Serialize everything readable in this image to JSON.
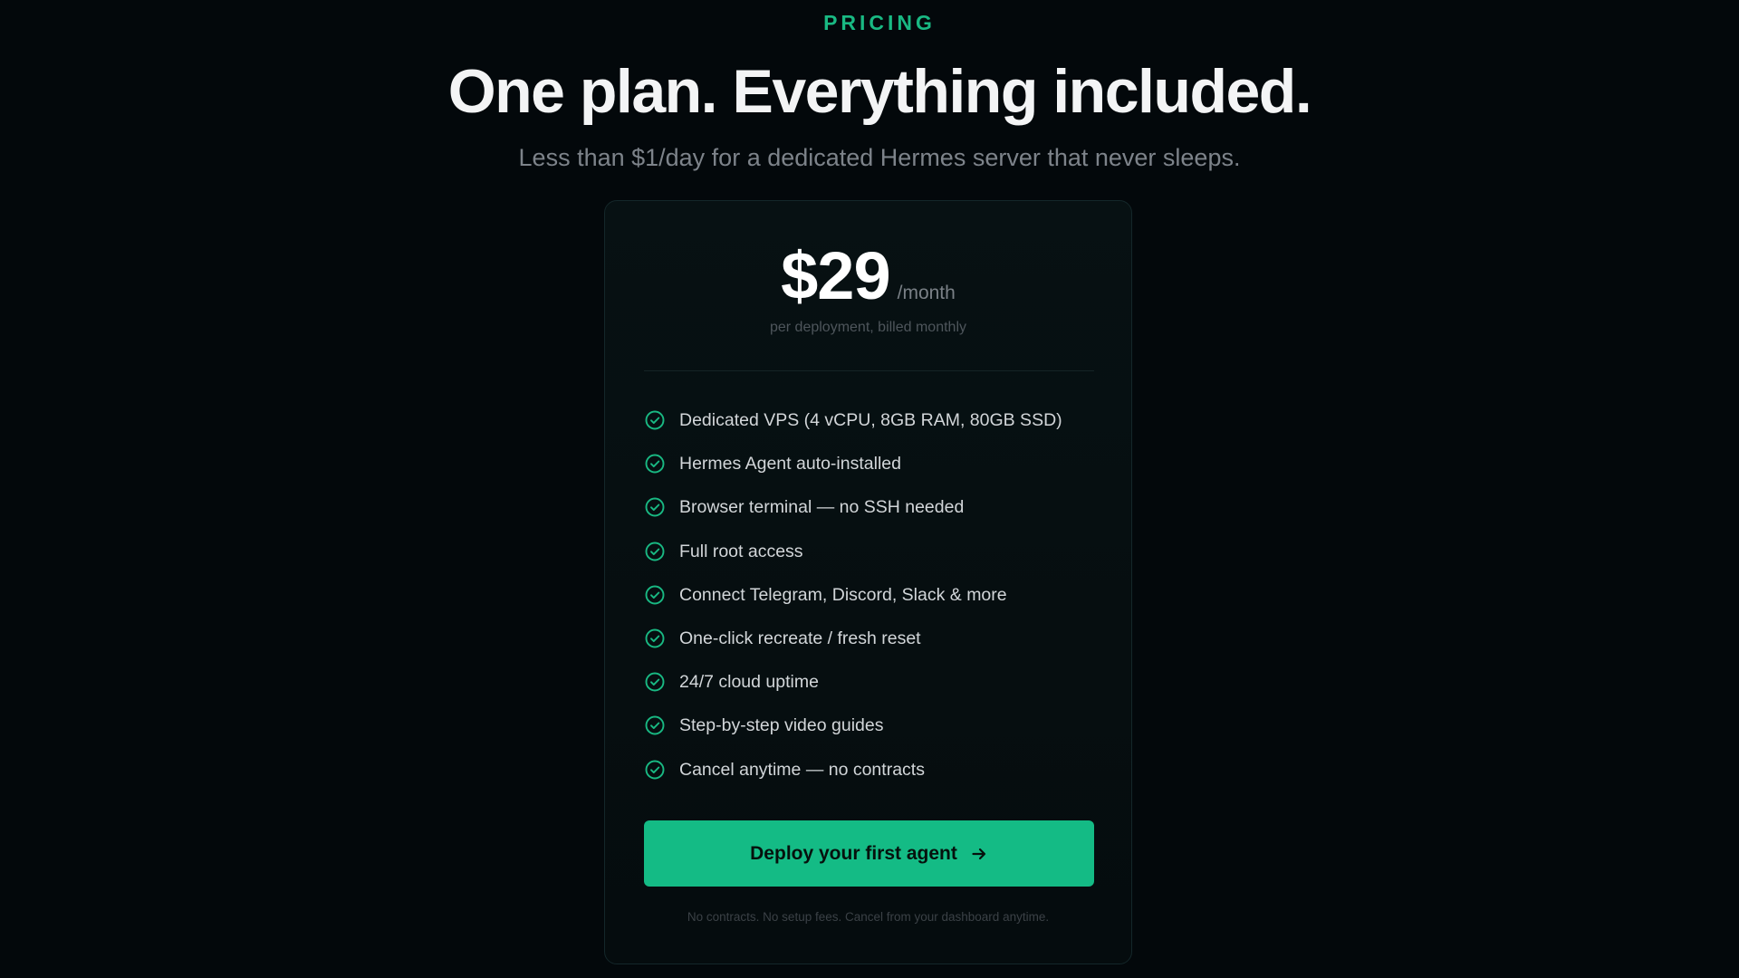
{
  "header": {
    "eyebrow": "PRICING",
    "title": "One plan. Everything included.",
    "subtitle": "Less than $1/day for a dedicated Hermes server that never sleeps."
  },
  "plan": {
    "price": "$29",
    "period": "/month",
    "note": "per deployment, billed monthly",
    "features": [
      "Dedicated VPS (4 vCPU, 8GB RAM, 80GB SSD)",
      "Hermes Agent auto-installed",
      "Browser terminal — no SSH needed",
      "Full root access",
      "Connect Telegram, Discord, Slack & more",
      "One-click recreate / fresh reset",
      "24/7 cloud uptime",
      "Step-by-step video guides",
      "Cancel anytime — no contracts"
    ],
    "feature_icon": "check-circle-icon",
    "cta_label": "Deploy your first agent",
    "cta_icon": "arrow-right-icon",
    "fine_print": "No contracts. No setup fees. Cancel from your dashboard anytime."
  },
  "colors": {
    "background": "#03080b",
    "accent": "#14bb85",
    "heading": "#f3f4f5",
    "muted": "#7d838a"
  }
}
